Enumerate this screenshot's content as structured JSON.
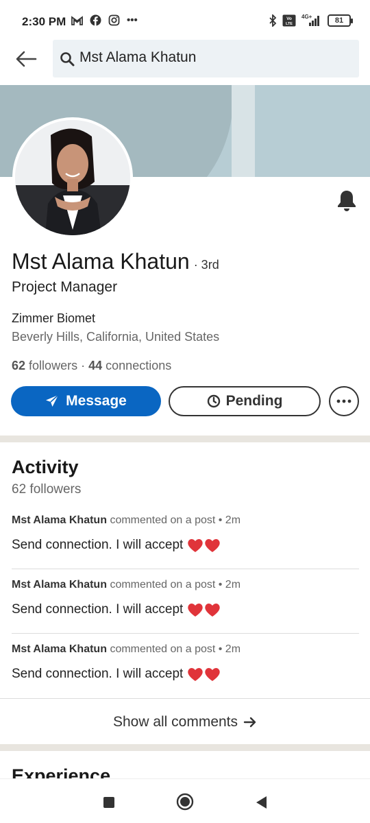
{
  "status_bar": {
    "time": "2:30 PM",
    "left_icons": [
      "gmail-icon",
      "facebook-icon",
      "instagram-icon",
      "more-dots-icon"
    ],
    "right_icons": [
      "bluetooth-icon",
      "volte-icon",
      "signal-icon"
    ],
    "network": "4G+",
    "volte": "Vo LTE",
    "battery": "81"
  },
  "search": {
    "value": "Mst Alama Khatun"
  },
  "profile": {
    "name": "Mst Alama Khatun",
    "degree": "· 3rd",
    "headline": "Project Manager",
    "company": "Zimmer Biomet",
    "location": "Beverly Hills, California, United States",
    "followers_count": "62",
    "followers_label": "followers",
    "separator": "·",
    "connections_count": "44",
    "connections_label": "connections"
  },
  "actions": {
    "message_label": "Message",
    "pending_label": "Pending"
  },
  "activity": {
    "title": "Activity",
    "followers": "62 followers",
    "items": [
      {
        "author": "Mst Alama Khatun",
        "action": "commented on a post • 2m",
        "text": "Send connection. I will accept"
      },
      {
        "author": "Mst Alama Khatun",
        "action": "commented on a post • 2m",
        "text": "Send connection. I will accept"
      },
      {
        "author": "Mst Alama Khatun",
        "action": "commented on a post • 2m",
        "text": "Send connection. I will accept"
      }
    ],
    "show_all_label": "Show all comments"
  },
  "experience": {
    "title": "Experience"
  },
  "colors": {
    "primary": "#0a66c2",
    "banner": "#b7cdd4",
    "divider": "#e8e5df"
  }
}
